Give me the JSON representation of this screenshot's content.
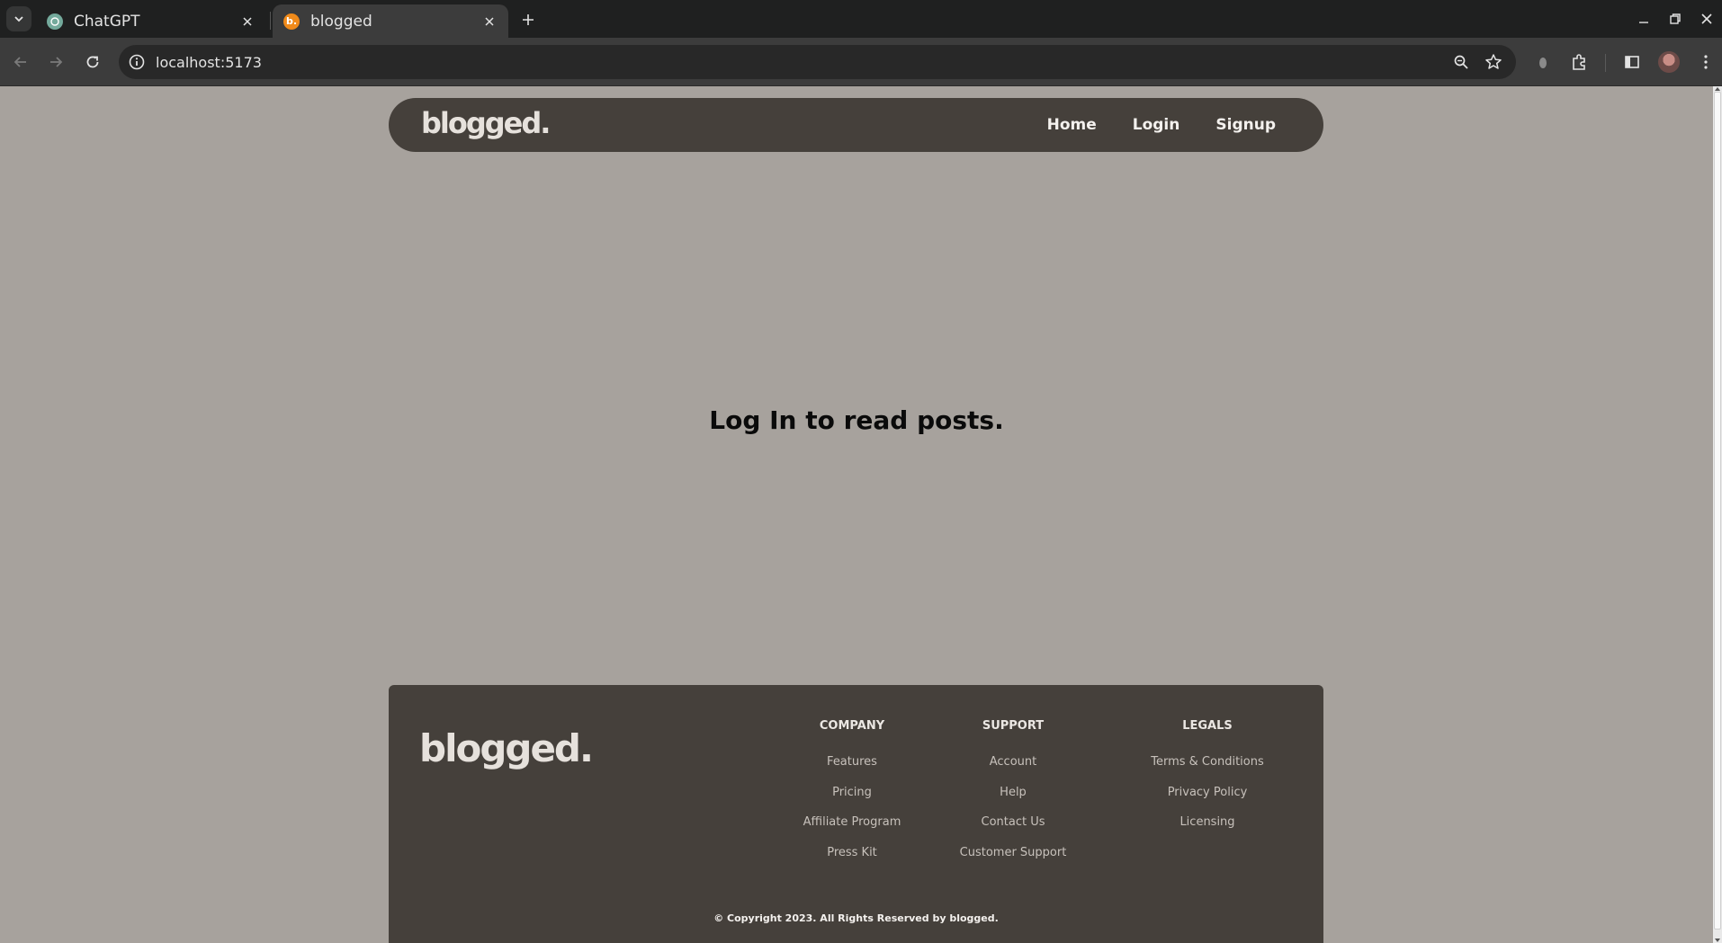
{
  "browser": {
    "tabs": [
      {
        "title": "ChatGPT",
        "favicon": "openai-favicon",
        "active": false
      },
      {
        "title": "blogged",
        "favicon": "blogged-favicon",
        "favicon_text": "b.",
        "active": true
      }
    ],
    "url": "localhost:5173"
  },
  "nav": {
    "logo": "blogged.",
    "links": [
      "Home",
      "Login",
      "Signup"
    ]
  },
  "main": {
    "message": "Log In to read posts."
  },
  "footer": {
    "logo": "blogged.",
    "columns": [
      {
        "heading": "COMPANY",
        "items": [
          "Features",
          "Pricing",
          "Affiliate Program",
          "Press Kit"
        ]
      },
      {
        "heading": "SUPPORT",
        "items": [
          "Account",
          "Help",
          "Contact Us",
          "Customer Support"
        ]
      },
      {
        "heading": "LEGALS",
        "items": [
          "Terms & Conditions",
          "Privacy Policy",
          "Licensing"
        ]
      }
    ],
    "copyright": "© Copyright 2023. All Rights Reserved by blogged."
  },
  "colors": {
    "page_bg": "#a7a29d",
    "nav_bg": "#45403b",
    "footer_bg": "#45403b",
    "logo_color": "#e6e1dc",
    "favicon_accent": "#f08a1a"
  }
}
